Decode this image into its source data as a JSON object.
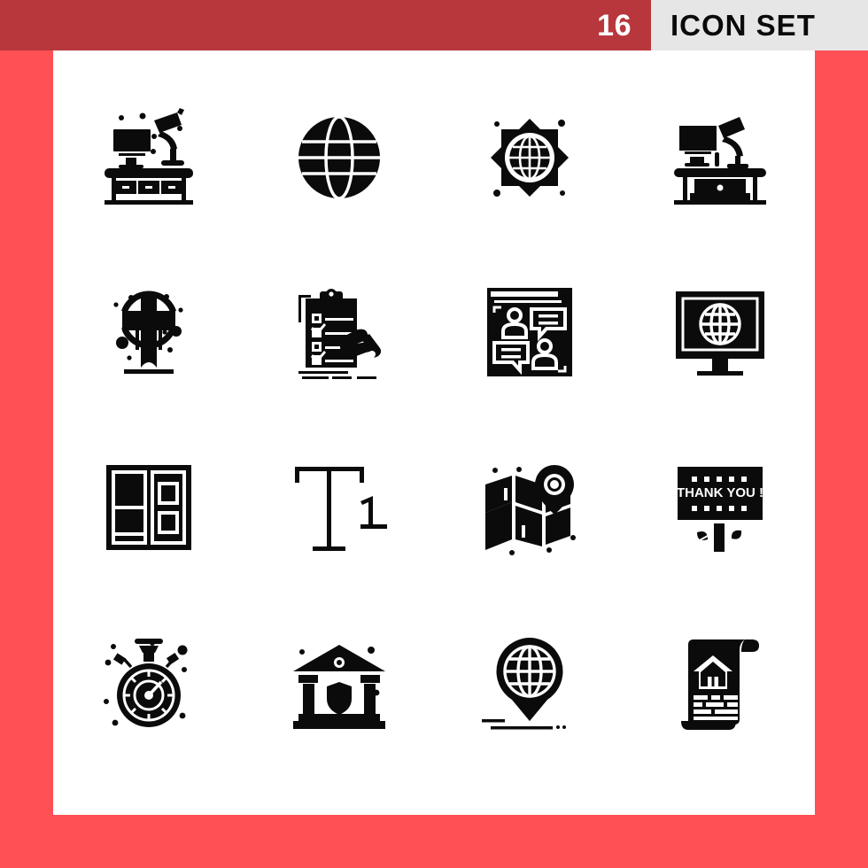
{
  "header": {
    "count": "16",
    "title": "ICON SET",
    "red_color": "#b8373c",
    "gray_color": "#e6e6e6",
    "count_color": "#ffffff",
    "title_color": "#0a0a0a"
  },
  "page": {
    "background_color": "#ff5056",
    "card_color": "#ffffff",
    "icon_color": "#0b0b0b"
  },
  "icons": [
    {
      "name": "desk-workspace-monitor-lamp-icon",
      "label": "Desk with monitor and lamp",
      "row": 1,
      "col": 1
    },
    {
      "name": "globe-grid-icon",
      "label": "Globe",
      "row": 1,
      "col": 2
    },
    {
      "name": "globe-badge-star-icon",
      "label": "Globe in star badge",
      "row": 1,
      "col": 3
    },
    {
      "name": "workspace-desk-lamp-icon",
      "label": "Workspace desk with lamp",
      "row": 1,
      "col": 4
    },
    {
      "name": "celtic-cross-monument-icon",
      "label": "Celtic cross monument",
      "row": 2,
      "col": 1
    },
    {
      "name": "clipboard-checklist-hand-icon",
      "label": "Clipboard checklist with hand",
      "row": 2,
      "col": 2
    },
    {
      "name": "chat-conversation-users-icon",
      "label": "Users chat conversation",
      "row": 2,
      "col": 3
    },
    {
      "name": "monitor-globe-icon",
      "label": "Monitor with globe",
      "row": 2,
      "col": 4
    },
    {
      "name": "window-panels-icon",
      "label": "Window panels",
      "row": 3,
      "col": 1
    },
    {
      "name": "text-heading-t1-icon",
      "label": "Heading text T1",
      "row": 3,
      "col": 2
    },
    {
      "name": "folded-map-pin-icon",
      "label": "Folded map with pin",
      "row": 3,
      "col": 3
    },
    {
      "name": "billboard-thank-you-icon",
      "label": "Thank you billboard",
      "row": 3,
      "col": 4,
      "text": "THANK YOU !"
    },
    {
      "name": "stopwatch-icon",
      "label": "Stopwatch",
      "row": 4,
      "col": 1
    },
    {
      "name": "bank-shield-icon",
      "label": "Bank with shield",
      "row": 4,
      "col": 2
    },
    {
      "name": "globe-location-pin-icon",
      "label": "Globe location pin",
      "row": 4,
      "col": 3
    },
    {
      "name": "property-document-house-icon",
      "label": "House document",
      "row": 4,
      "col": 4
    }
  ]
}
